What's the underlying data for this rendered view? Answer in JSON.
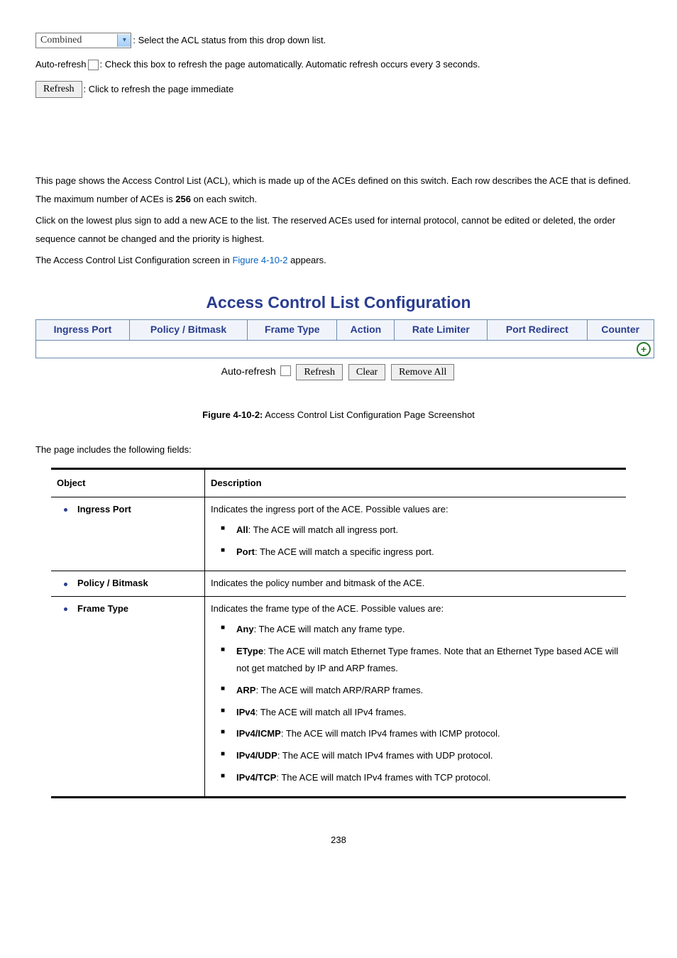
{
  "controls": {
    "dropdown_value": "Combined",
    "dropdown_desc": ": Select the ACL status from this drop down list.",
    "autorefresh_label": "Auto-refresh ",
    "autorefresh_desc": ": Check this box to refresh the page automatically. Automatic refresh occurs every 3 seconds.",
    "refresh_btn": "Refresh",
    "refresh_desc": ": Click to refresh the page immediate"
  },
  "intro": {
    "p1a": "This page shows the Access Control List (ACL), which is made up of the ACEs defined on this switch. Each row describes the ACE that is defined. The maximum number of ACEs is ",
    "p1b": "256",
    "p1c": " on each switch.",
    "p2": "Click on the lowest plus sign to add a new ACE to the list. The reserved ACEs used for internal protocol, cannot be edited or deleted, the order sequence cannot be changed and the priority is highest.",
    "p3a": "The Access Control List Configuration screen in ",
    "p3link": "Figure 4-10-2",
    "p3b": " appears."
  },
  "acl": {
    "title": "Access Control List Configuration",
    "headers": [
      "Ingress Port",
      "Policy / Bitmask",
      "Frame Type",
      "Action",
      "Rate Limiter",
      "Port Redirect",
      "Counter"
    ],
    "controls_label": "Auto-refresh",
    "btn_refresh": "Refresh",
    "btn_clear": "Clear",
    "btn_removeall": "Remove All",
    "caption_prefix": "Figure 4-10-2:",
    "caption": " Access Control List Configuration Page Screenshot"
  },
  "fields": {
    "intro": "The page includes the following fields:",
    "th_object": "Object",
    "th_desc": "Description",
    "rows": [
      {
        "object": "Ingress Port",
        "desc_lead": "Indicates the ingress port of the ACE. Possible values are:",
        "items": [
          {
            "term": "All",
            "text": ": The ACE will match all ingress port."
          },
          {
            "term": "Port",
            "text": ": The ACE will match a specific ingress port."
          }
        ]
      },
      {
        "object": "Policy / Bitmask",
        "desc_lead": "Indicates the policy number and bitmask of the ACE.",
        "items": []
      },
      {
        "object": "Frame Type",
        "desc_lead": "Indicates the frame type of the ACE. Possible values are:",
        "items": [
          {
            "term": "Any",
            "text": ": The ACE will match any frame type."
          },
          {
            "term": "EType",
            "text": ": The ACE will match Ethernet Type frames. Note that an Ethernet Type based ACE will not get matched by IP and ARP frames."
          },
          {
            "term": "ARP",
            "text": ": The ACE will match ARP/RARP frames."
          },
          {
            "term": "IPv4",
            "text": ": The ACE will match all IPv4 frames."
          },
          {
            "term": "IPv4/ICMP",
            "text": ": The ACE will match IPv4 frames with ICMP protocol."
          },
          {
            "term": "IPv4/UDP",
            "text": ": The ACE will match IPv4 frames with UDP protocol."
          },
          {
            "term": "IPv4/TCP",
            "text": ": The ACE will match IPv4 frames with TCP protocol."
          }
        ]
      }
    ]
  },
  "page_number": "238"
}
